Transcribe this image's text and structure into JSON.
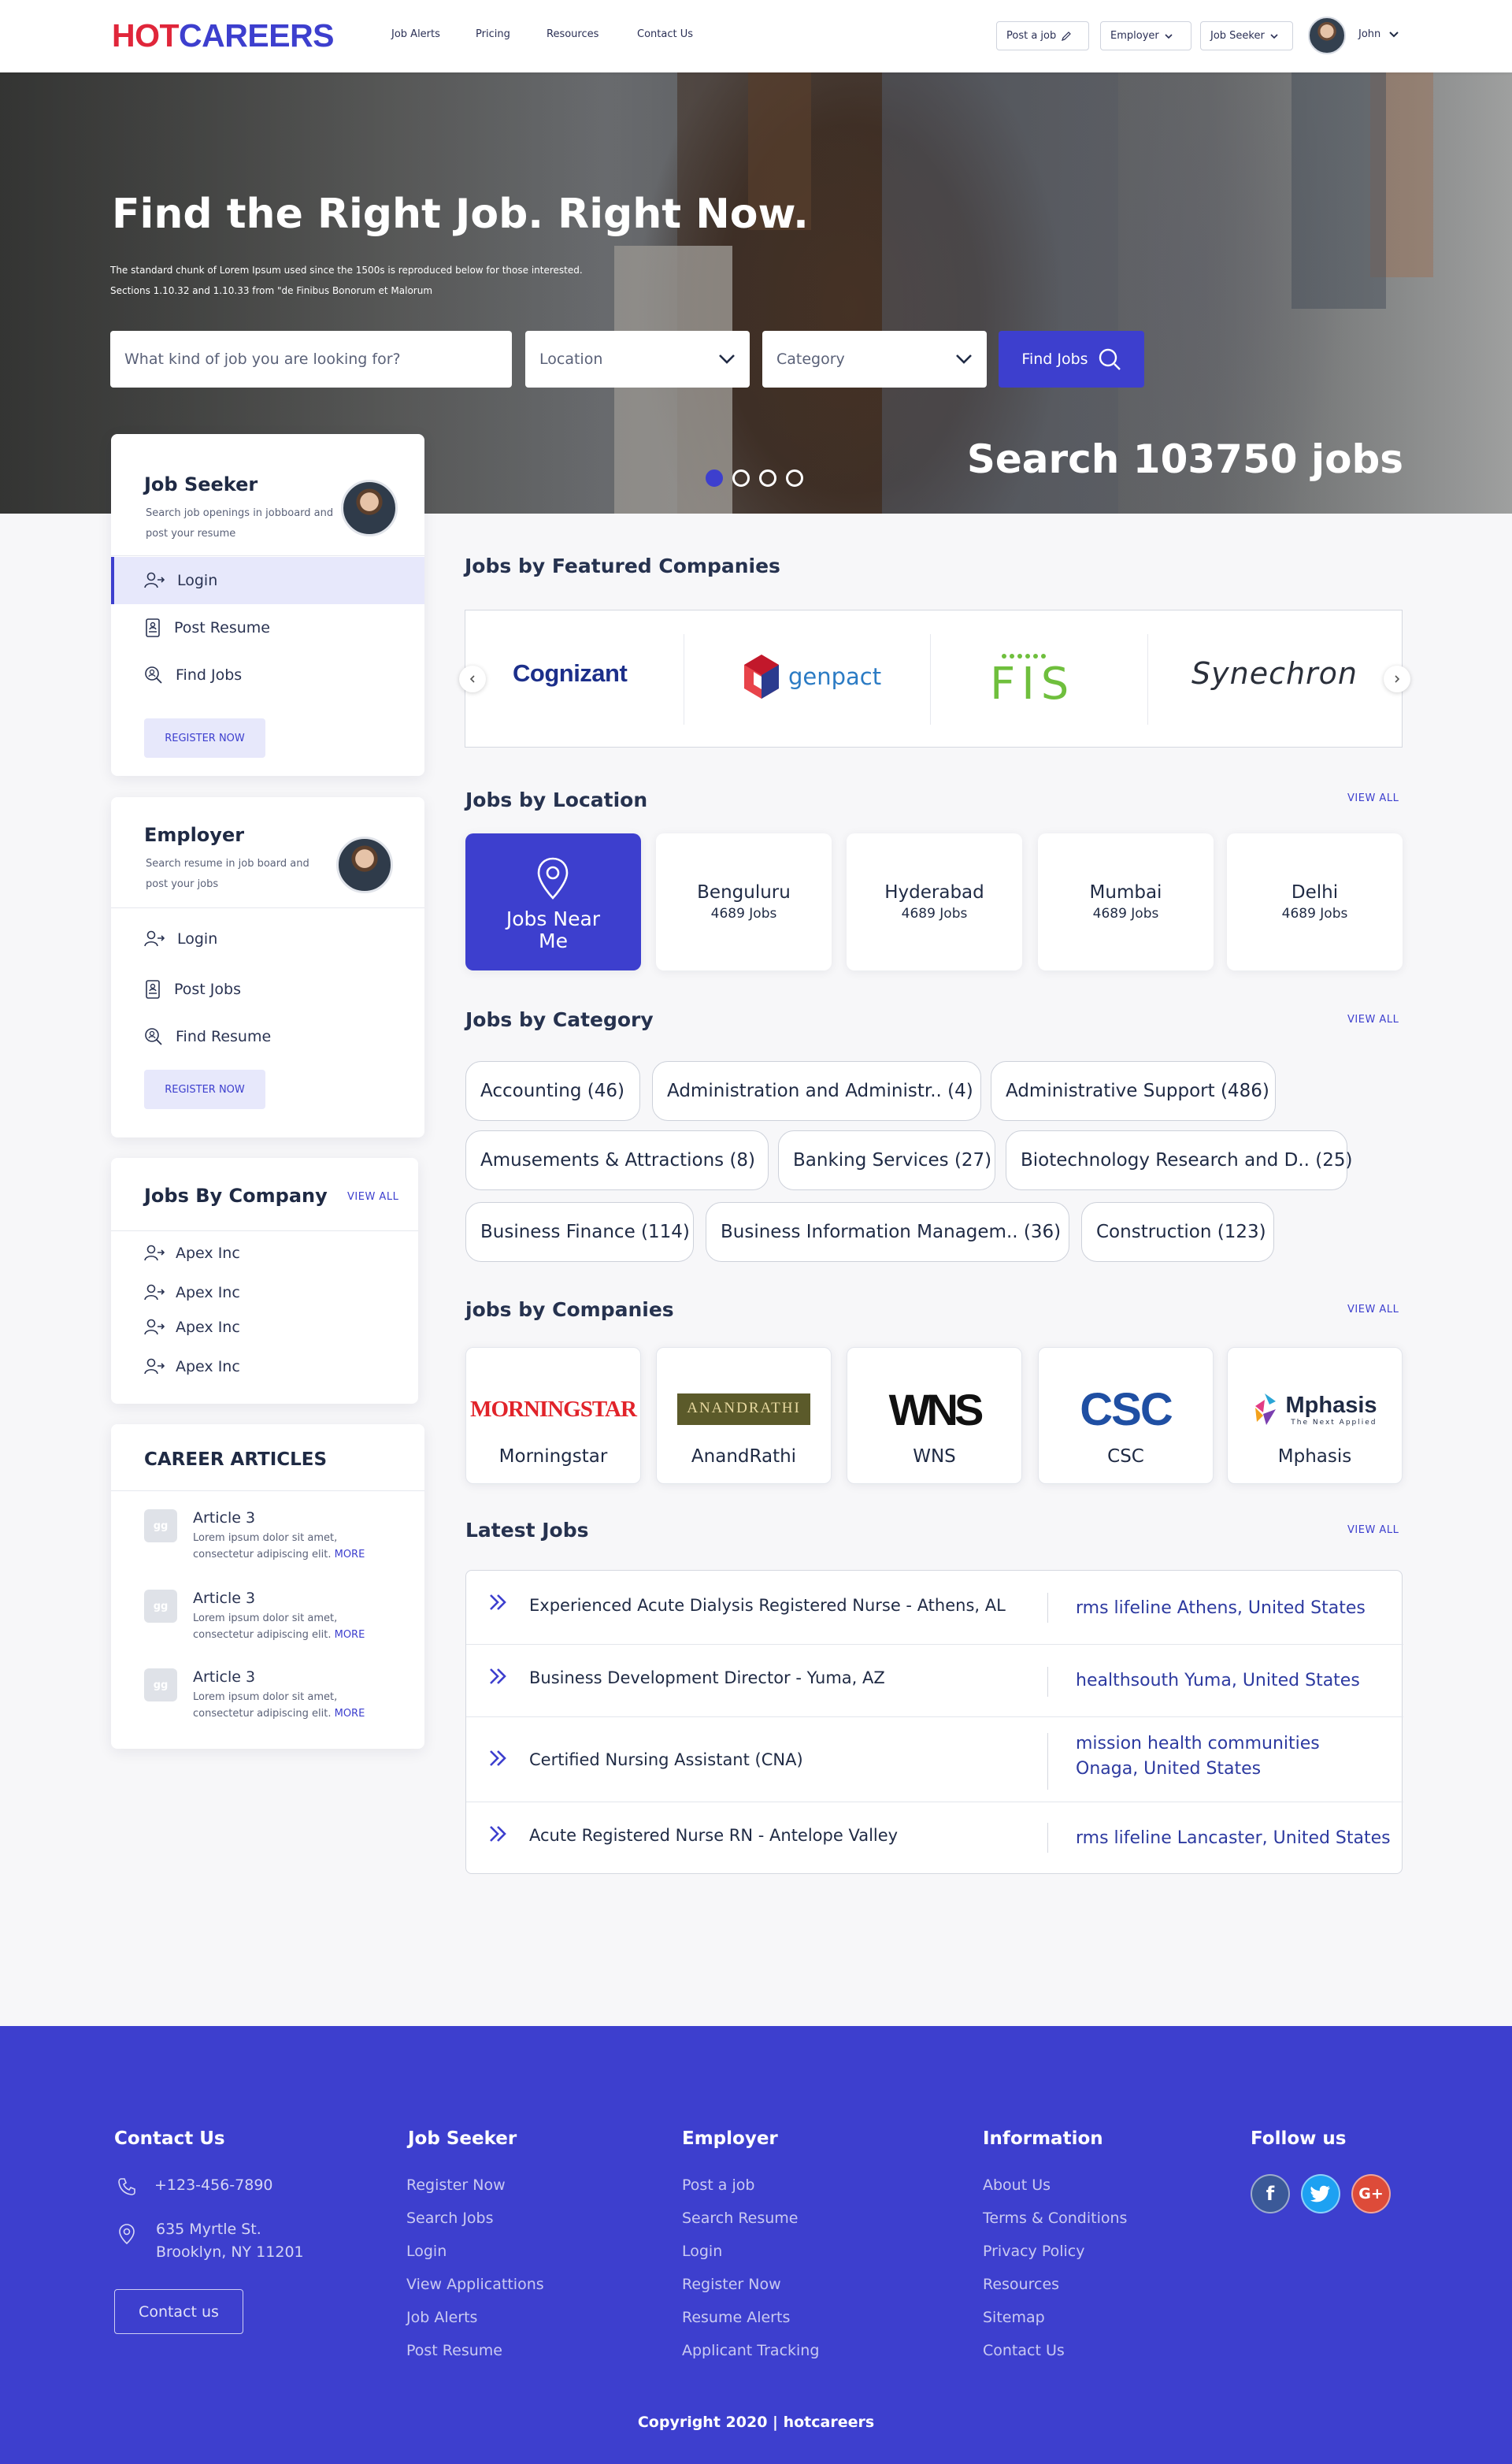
{
  "header": {
    "logo_hot": "HOT",
    "logo_careers": "CAREERS",
    "nav": [
      "Job Alerts",
      "Pricing",
      "Resources",
      "Contact Us"
    ],
    "post_job": "Post a job",
    "employer": "Employer",
    "job_seeker": "Job Seeker",
    "user_name": "John"
  },
  "hero": {
    "title": "Find the Right Job. Right Now.",
    "subtitle": "The standard chunk of Lorem Ipsum used since the 1500s is reproduced below for those interested. Sections 1.10.32 and 1.10.33 from \"de Finibus Bonorum et Malorum",
    "search_placeholder": "What kind of job you are looking for?",
    "location": "Location",
    "category": "Category",
    "find_button": "Find Jobs",
    "count_text": "Search 103750 jobs",
    "active_slide": 1,
    "slides": 4
  },
  "job_seeker_card": {
    "title": "Job Seeker",
    "desc": "Search job openings in jobboard and post your resume",
    "items": [
      "Login",
      "Post Resume",
      "Find Jobs"
    ],
    "register": "REGISTER NOW"
  },
  "employer_card": {
    "title": "Employer",
    "desc": "Search resume in job board and post your jobs",
    "items": [
      "Login",
      "Post Jobs",
      "Find Resume"
    ],
    "register": "REGISTER NOW"
  },
  "jobs_by_company_card": {
    "title": "Jobs By Company",
    "view_all": "VIEW ALL",
    "items": [
      "Apex Inc",
      "Apex Inc",
      "Apex Inc",
      "Apex Inc"
    ]
  },
  "career_articles": {
    "title": "CAREER ARTICLES",
    "items": [
      {
        "icon": "gg",
        "title": "Article 3",
        "body": "Lorem ipsum dolor sit amet, consectetur adipiscing elit.",
        "more": "MORE"
      },
      {
        "icon": "gg",
        "title": "Article 3",
        "body": "Lorem ipsum dolor sit amet, consectetur adipiscing elit.",
        "more": "MORE"
      },
      {
        "icon": "gg",
        "title": "Article 3",
        "body": "Lorem ipsum dolor sit amet, consectetur adipiscing elit.",
        "more": "MORE"
      }
    ]
  },
  "featured": {
    "title": "Jobs by Featured Companies",
    "companies": [
      "Cognizant",
      "genpact",
      "FIS",
      "Synechron"
    ]
  },
  "location": {
    "title": "Jobs by Location",
    "view_all": "VIEW ALL",
    "near_me": "Jobs Near Me",
    "items": [
      {
        "name": "Benguluru",
        "count": "4689 Jobs"
      },
      {
        "name": "Hyderabad",
        "count": "4689 Jobs"
      },
      {
        "name": "Mumbai",
        "count": "4689 Jobs"
      },
      {
        "name": "Delhi",
        "count": "4689 Jobs"
      }
    ]
  },
  "category": {
    "title": "Jobs by Category",
    "view_all": "VIEW ALL",
    "chips": [
      "Accounting (46)",
      "Administration and Administr.. (4)",
      "Administrative Support (486)",
      "Amusements & Attractions (8)",
      "Banking Services (27)",
      "Biotechnology Research and D.. (25)",
      "Business Finance (114)",
      "Business Information Managem.. (36)",
      "Construction (123)"
    ]
  },
  "companies": {
    "title": "jobs by Companies",
    "view_all": "VIEW ALL",
    "items": [
      {
        "name": "Morningstar",
        "logo": "MORNINGSTAR"
      },
      {
        "name": "AnandRathi",
        "logo": "ANANDRATHI"
      },
      {
        "name": "WNS",
        "logo": "WNS"
      },
      {
        "name": "CSC",
        "logo": "CSC"
      },
      {
        "name": "Mphasis",
        "logo": "Mphasis",
        "logo_tag": "The Next Applied"
      }
    ]
  },
  "latest": {
    "title": "Latest Jobs",
    "view_all": "VIEW ALL",
    "jobs": [
      {
        "title": "Experienced Acute Dialysis Registered Nurse - Athens, AL",
        "company": "rms lifeline Athens, United States"
      },
      {
        "title": "Business Development Director - Yuma, AZ",
        "company": "healthsouth Yuma, United States"
      },
      {
        "title": "Certified Nursing Assistant (CNA)",
        "company": "mission health communities Onaga, United States"
      },
      {
        "title": "Acute Registered Nurse RN - Antelope Valley",
        "company": "rms lifeline Lancaster, United States"
      }
    ]
  },
  "footer": {
    "contact_title": "Contact Us",
    "phone": "+123-456-7890",
    "address_line1": "635 Myrtle St.",
    "address_line2": "Brooklyn, NY 11201",
    "contact_button": "Contact us",
    "job_seeker_title": "Job Seeker",
    "job_seeker_links": [
      "Register Now",
      "Search Jobs",
      "Login",
      "View Applicattions",
      "Job Alerts",
      "Post Resume"
    ],
    "employer_title": "Employer",
    "employer_links": [
      "Post a job",
      "Search Resume",
      "Login",
      "Register Now",
      "Resume Alerts",
      "Applicant Tracking"
    ],
    "info_title": "Information",
    "info_links": [
      "About Us",
      "Terms & Conditions",
      "Privacy Policy",
      "Resources",
      "Sitemap",
      "Contact Us"
    ],
    "follow_title": "Follow us",
    "social": [
      {
        "icon": "facebook-icon",
        "glyph": "f",
        "color": "#3b5998"
      },
      {
        "icon": "twitter-icon",
        "glyph": "t",
        "color": "#1da1f2"
      },
      {
        "icon": "google-plus-icon",
        "glyph": "G+",
        "color": "#dd4b39"
      }
    ],
    "copyright": "Copyright 2020 | hotcareers"
  },
  "colors": {
    "brand": "#3d3fce",
    "logo_red": "#e0263a"
  }
}
